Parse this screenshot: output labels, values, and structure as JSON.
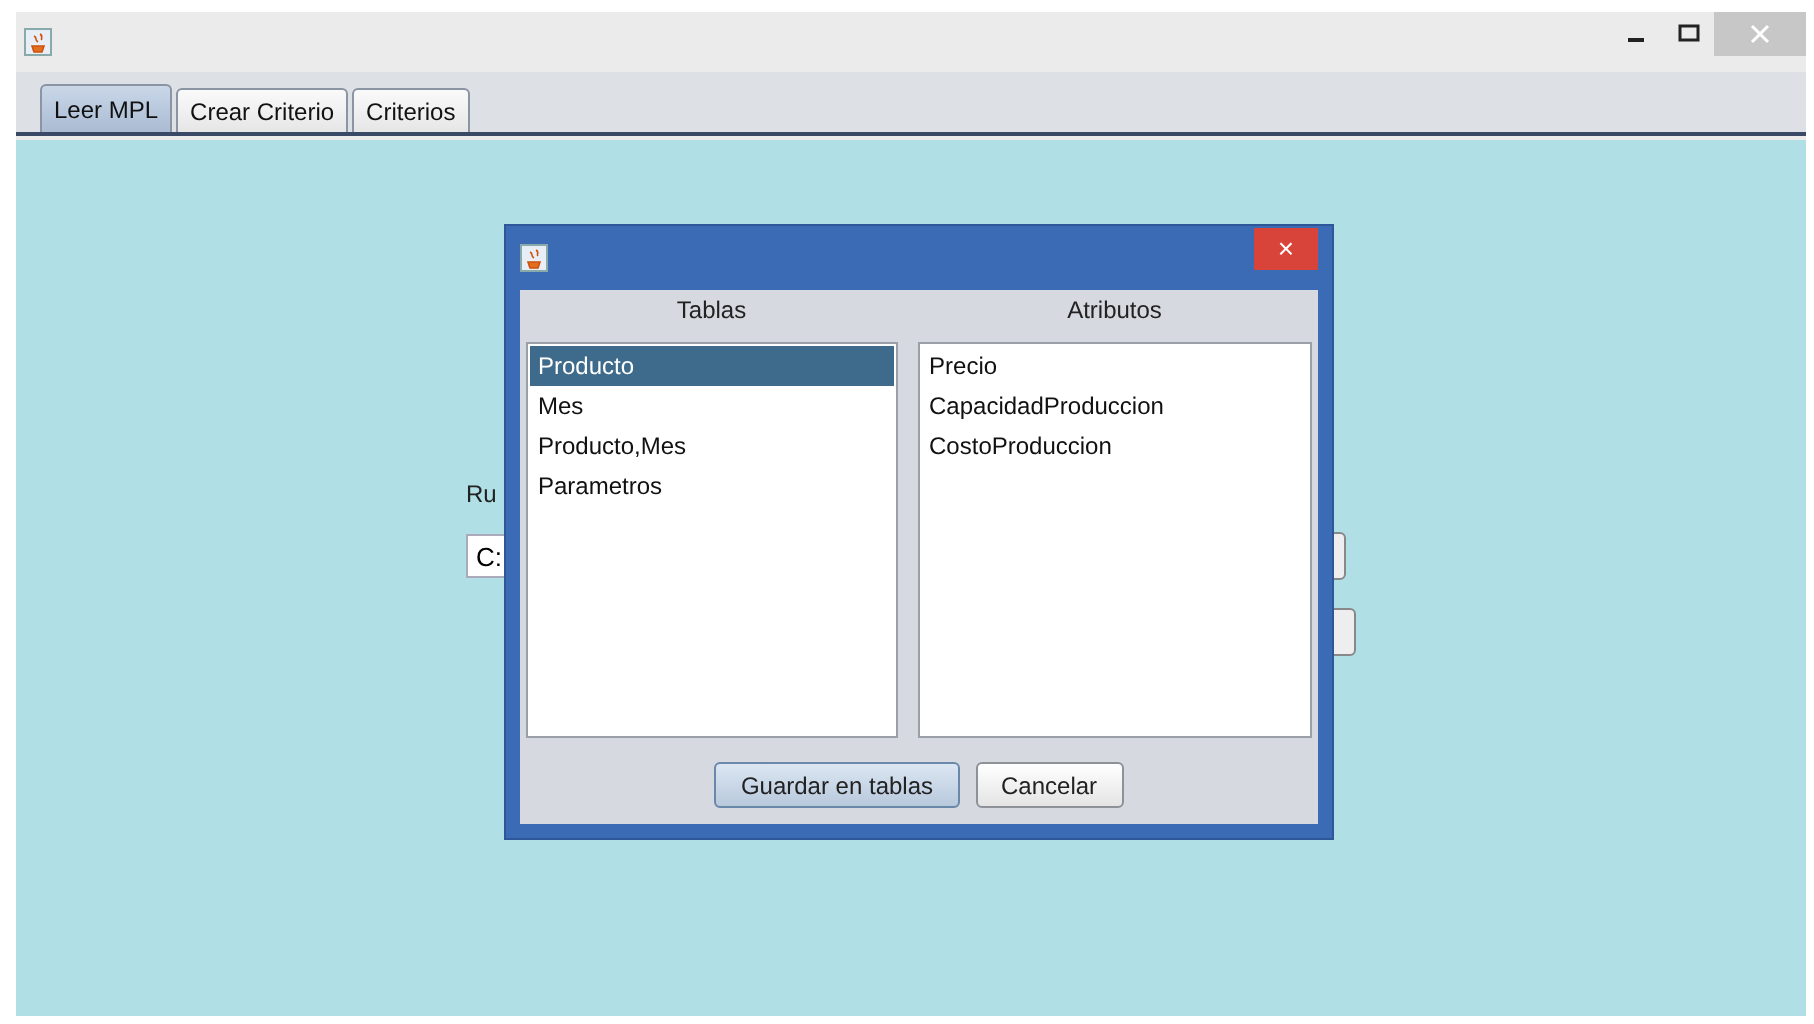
{
  "tabs": [
    {
      "label": "Leer MPL",
      "selected": true
    },
    {
      "label": "Crear Criterio",
      "selected": false
    },
    {
      "label": "Criterios",
      "selected": false
    }
  ],
  "background_form": {
    "label": "Ru",
    "field_value": "C:"
  },
  "dialog": {
    "close": "×",
    "tables": {
      "heading": "Tablas",
      "items": [
        {
          "label": "Producto",
          "selected": true
        },
        {
          "label": "Mes",
          "selected": false
        },
        {
          "label": "Producto,Mes",
          "selected": false
        },
        {
          "label": "Parametros",
          "selected": false
        }
      ]
    },
    "attributes": {
      "heading": "Atributos",
      "items": [
        {
          "label": "Precio",
          "selected": false
        },
        {
          "label": "CapacidadProduccion",
          "selected": false
        },
        {
          "label": "CostoProduccion",
          "selected": false
        }
      ]
    },
    "buttons": [
      {
        "label": "Guardar en tablas",
        "focused": true
      },
      {
        "label": "Cancelar",
        "focused": false
      }
    ]
  }
}
